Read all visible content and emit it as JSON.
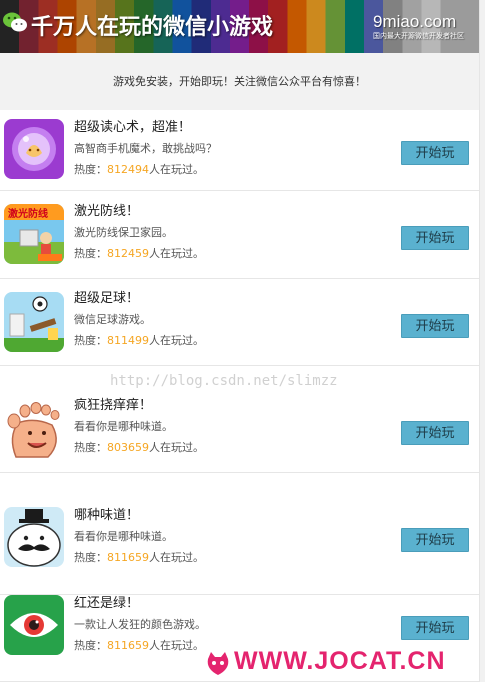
{
  "banner": {
    "title": "千万人在玩的微信小游戏",
    "brand": "9miao.com",
    "brand_tagline": "国内最大开源微信开发者社区"
  },
  "notice": "游戏免安装，开始即玩！关注微信公众平台有惊喜！",
  "games": [
    {
      "name": "超级读心术，超准！",
      "desc": "高智商手机魔术，敢挑战吗？",
      "heat_label": "热度：",
      "heat_count": "812494",
      "heat_suffix": "人在玩过。",
      "button": "开始玩",
      "icon": "crystal-ball-icon"
    },
    {
      "name": "激光防线！",
      "desc": "激光防线保卫家园。",
      "heat_label": "热度：",
      "heat_count": "812459",
      "heat_suffix": "人在玩过。",
      "button": "开始玩",
      "icon": "laser-defense-icon"
    },
    {
      "name": "超级足球！",
      "desc": "微信足球游戏。",
      "heat_label": "热度：",
      "heat_count": "811499",
      "heat_suffix": "人在玩过。",
      "button": "开始玩",
      "icon": "soccer-ball-icon"
    },
    {
      "name": "疯狂挠痒痒！",
      "desc": "看看你是哪种味道。",
      "heat_label": "热度：",
      "heat_count": "803659",
      "heat_suffix": "人在玩过。",
      "button": "开始玩",
      "icon": "foot-icon"
    },
    {
      "name": "哪种味道！",
      "desc": "看看你是哪种味道。",
      "heat_label": "热度：",
      "heat_count": "811659",
      "heat_suffix": "人在玩过。",
      "button": "开始玩",
      "icon": "mustache-face-icon"
    },
    {
      "name": "红还是绿！",
      "desc": "一款让人发狂的颜色游戏。",
      "heat_label": "热度：",
      "heat_count": "811659",
      "heat_suffix": "人在玩过。",
      "button": "开始玩",
      "icon": "eye-icon"
    }
  ],
  "watermark": "http://blog.csdn.net/slimzz",
  "footer_mark": "WWW.JOCAT.CN",
  "colors": {
    "accent_button": "#5ab1cf",
    "heat_number": "#f5a623",
    "jocat": "#e4246e"
  }
}
